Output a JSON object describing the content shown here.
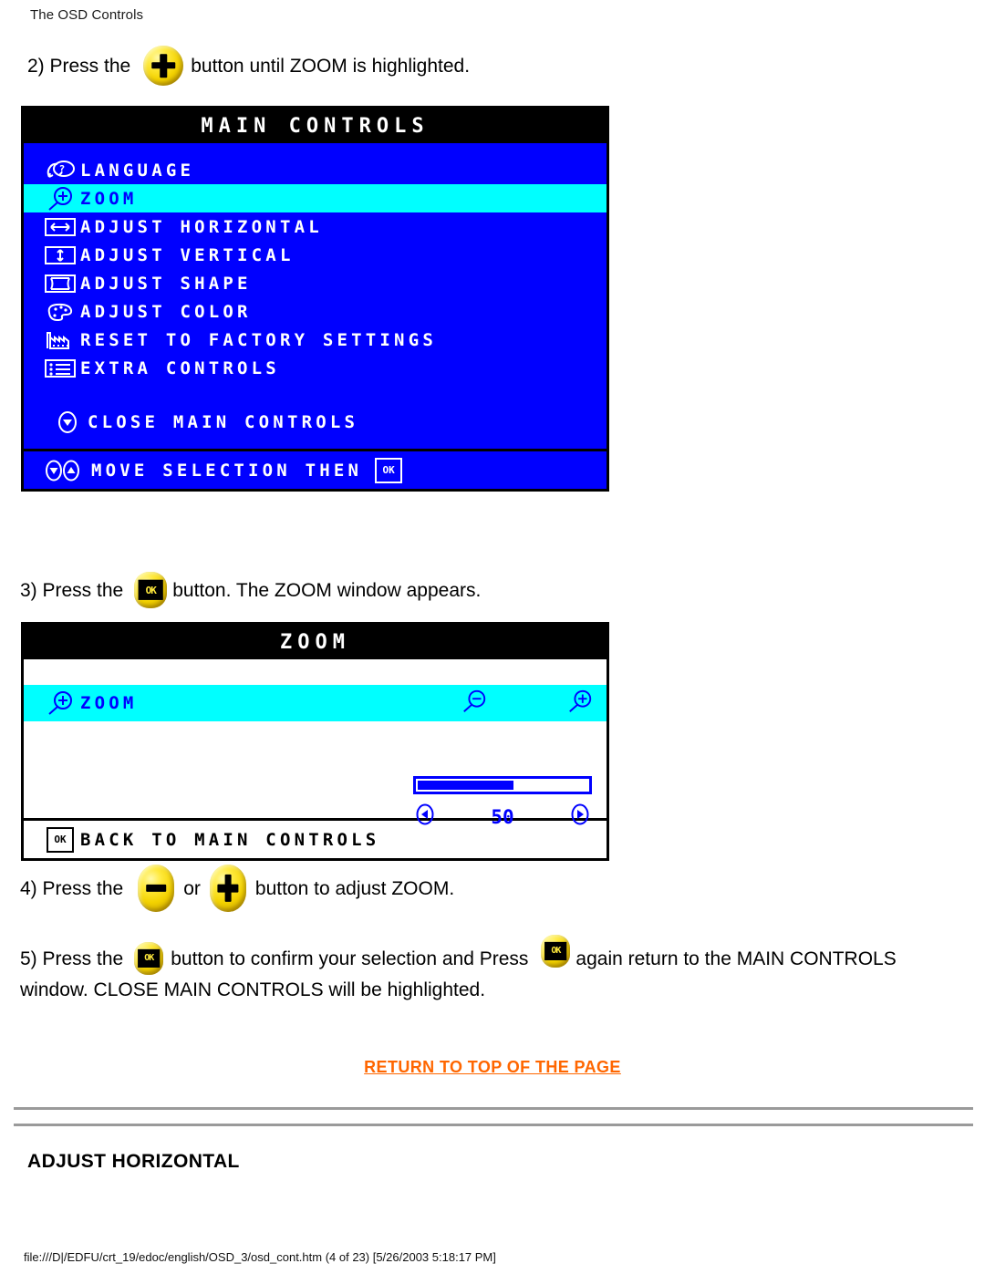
{
  "page_header": "The OSD Controls",
  "steps": {
    "step2": {
      "prefix": "2) Press the",
      "suffix": "button until ZOOM is highlighted."
    },
    "step3": {
      "prefix": "3) Press the",
      "suffix": "button. The ZOOM window appears."
    },
    "step4": {
      "prefix": "4) Press the",
      "middle": "or",
      "suffix": "button to adjust ZOOM."
    },
    "step5": {
      "prefix": "5) Press the",
      "middle": "button to confirm your selection and Press",
      "suffix": "again return to the MAIN CONTROLS",
      "line2": "window. CLOSE MAIN CONTROLS will be highlighted."
    }
  },
  "main_controls": {
    "title": "MAIN CONTROLS",
    "items": [
      {
        "label": "LANGUAGE",
        "icon": "language-icon",
        "selected": false
      },
      {
        "label": "ZOOM",
        "icon": "zoom-magnifier-plus-icon",
        "selected": true
      },
      {
        "label": "ADJUST HORIZONTAL",
        "icon": "horizontal-arrows-icon",
        "selected": false
      },
      {
        "label": "ADJUST VERTICAL",
        "icon": "vertical-arrows-icon",
        "selected": false
      },
      {
        "label": "ADJUST SHAPE",
        "icon": "shape-icon",
        "selected": false
      },
      {
        "label": "ADJUST COLOR",
        "icon": "palette-icon",
        "selected": false
      },
      {
        "label": "RESET TO FACTORY SETTINGS",
        "icon": "factory-icon",
        "selected": false
      },
      {
        "label": "EXTRA CONTROLS",
        "icon": "list-icon",
        "selected": false
      }
    ],
    "close_item": {
      "label": "CLOSE MAIN CONTROLS",
      "icon": "down-arrow-circle-icon"
    },
    "footer": {
      "label": "MOVE SELECTION THEN",
      "icons": "down-up-arrow-circles-icon",
      "ok_badge": "OK"
    }
  },
  "zoom_window": {
    "title": "ZOOM",
    "row": {
      "label": "ZOOM",
      "icon": "zoom-magnifier-plus-icon",
      "minus_icon": "magnifier-minus-icon",
      "plus_icon": "magnifier-plus-icon"
    },
    "slider": {
      "value": "50",
      "fill_percent": 55,
      "left_arrow": "◀",
      "right_arrow": "▶"
    },
    "footer": {
      "label": "BACK TO MAIN CONTROLS",
      "ok_badge": "OK"
    }
  },
  "return_link": "RETURN TO TOP OF THE PAGE",
  "section_heading": "ADJUST HORIZONTAL",
  "footer_path": "file:///D|/EDFU/crt_19/edoc/english/OSD_3/osd_cont.htm (4 of 23) [5/26/2003 5:18:17 PM]",
  "colors": {
    "osd_blue": "#0000FF",
    "osd_highlight": "#00FFFF",
    "link_orange": "#FF6600",
    "button_yellow": "#FFE93B"
  }
}
